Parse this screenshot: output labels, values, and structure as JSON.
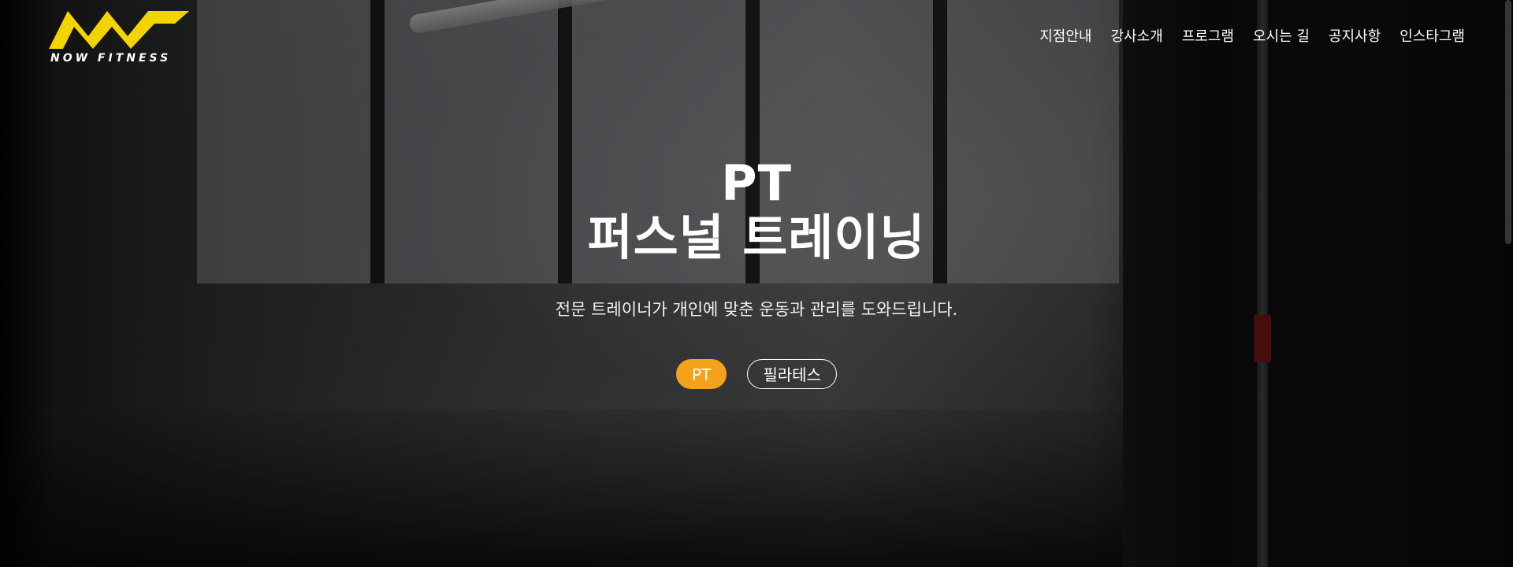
{
  "brand": {
    "name": "NOW FITNESS",
    "logo_color": "#F2D400"
  },
  "nav": {
    "items": [
      {
        "label": "지점안내"
      },
      {
        "label": "강사소개"
      },
      {
        "label": "프로그램"
      },
      {
        "label": "오시는 길"
      },
      {
        "label": "공지사항"
      },
      {
        "label": "인스타그램"
      }
    ]
  },
  "hero": {
    "title_line1": "PT",
    "title_line2": "퍼스널 트레이닝",
    "subtitle": "전문 트레이너가 개인에 맞춘 운동과 관리를 도와드립니다.",
    "tabs": [
      {
        "label": "PT",
        "active": true
      },
      {
        "label": "필라테스",
        "active": false
      }
    ]
  },
  "colors": {
    "accent": "#F5A21B",
    "text": "#FFFFFF"
  }
}
